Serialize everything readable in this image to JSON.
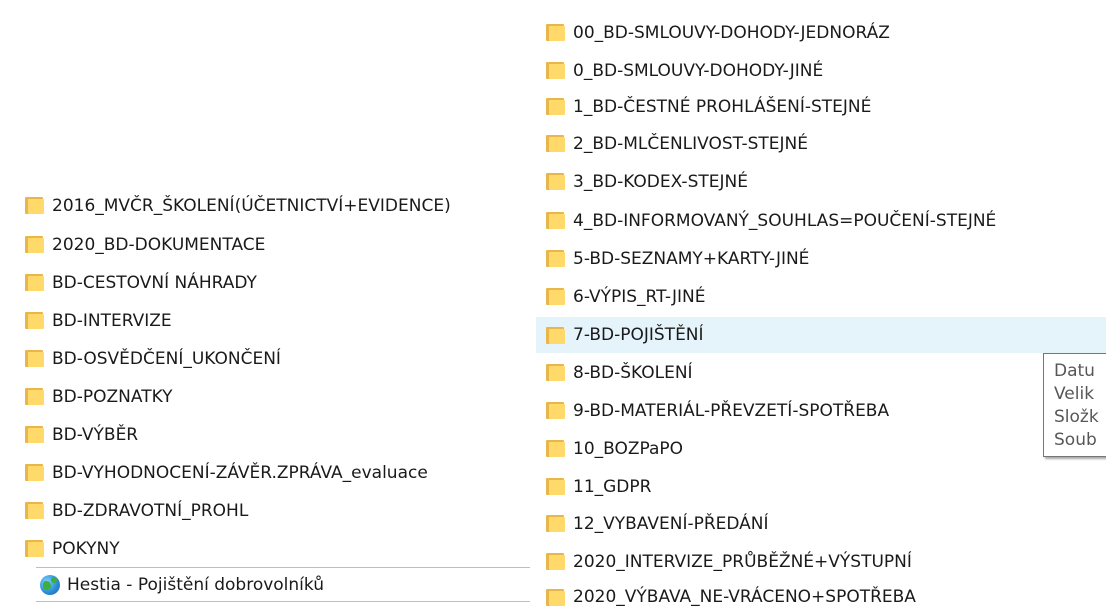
{
  "left_list": {
    "folders": [
      "2016_MVČR_ŠKOLENÍ(ÚČETNICTVÍ+EVIDENCE)",
      "2020_BD-DOKUMENTACE",
      "BD-CESTOVNÍ NÁHRADY",
      "BD-INTERVIZE",
      "BD-OSVĚDČENÍ_UKONČENÍ",
      "BD-POZNATKY",
      "BD-VÝBĚR",
      "BD-VYHODNOCENÍ-ZÁVĚR.ZPRÁVA_evaluace",
      "BD-ZDRAVOTNÍ_PROHL",
      "POKYNY"
    ],
    "shortcut": "Hestia - Pojištění dobrovolníků"
  },
  "right_list": {
    "folders": [
      "00_BD-SMLOUVY-DOHODY-JEDNORÁZ",
      "0_BD-SMLOUVY-DOHODY-JINÉ",
      "1_BD-ČESTNÉ PROHLÁŠENÍ-STEJNÉ",
      "2_BD-MLČENLIVOST-STEJNÉ",
      "3_BD-KODEX-STEJNÉ",
      "4_BD-INFORMOVANÝ_SOUHLAS=POUČENÍ-STEJNÉ",
      "5-BD-SEZNAMY+KARTY-JINÉ",
      "6-VÝPIS_RT-JINÉ",
      "7-BD-POJIŠTĚNÍ",
      "8-BD-ŠKOLENÍ",
      "9-BD-MATERIÁL-PŘEVZETÍ-SPOTŘEBA",
      "10_BOZPaPO",
      "11_GDPR",
      "12_VYBAVENÍ-PŘEDÁNÍ",
      "2020_INTERVIZE_PRŮBĚŽNÉ+VÝSTUPNÍ",
      "2020_VÝBAVA_NE-VRÁCENO+SPOTŘEBA"
    ],
    "hovered_index": 8
  },
  "tooltip": {
    "lines": [
      "Datu",
      "Velik",
      "Složk",
      "Soub"
    ]
  }
}
